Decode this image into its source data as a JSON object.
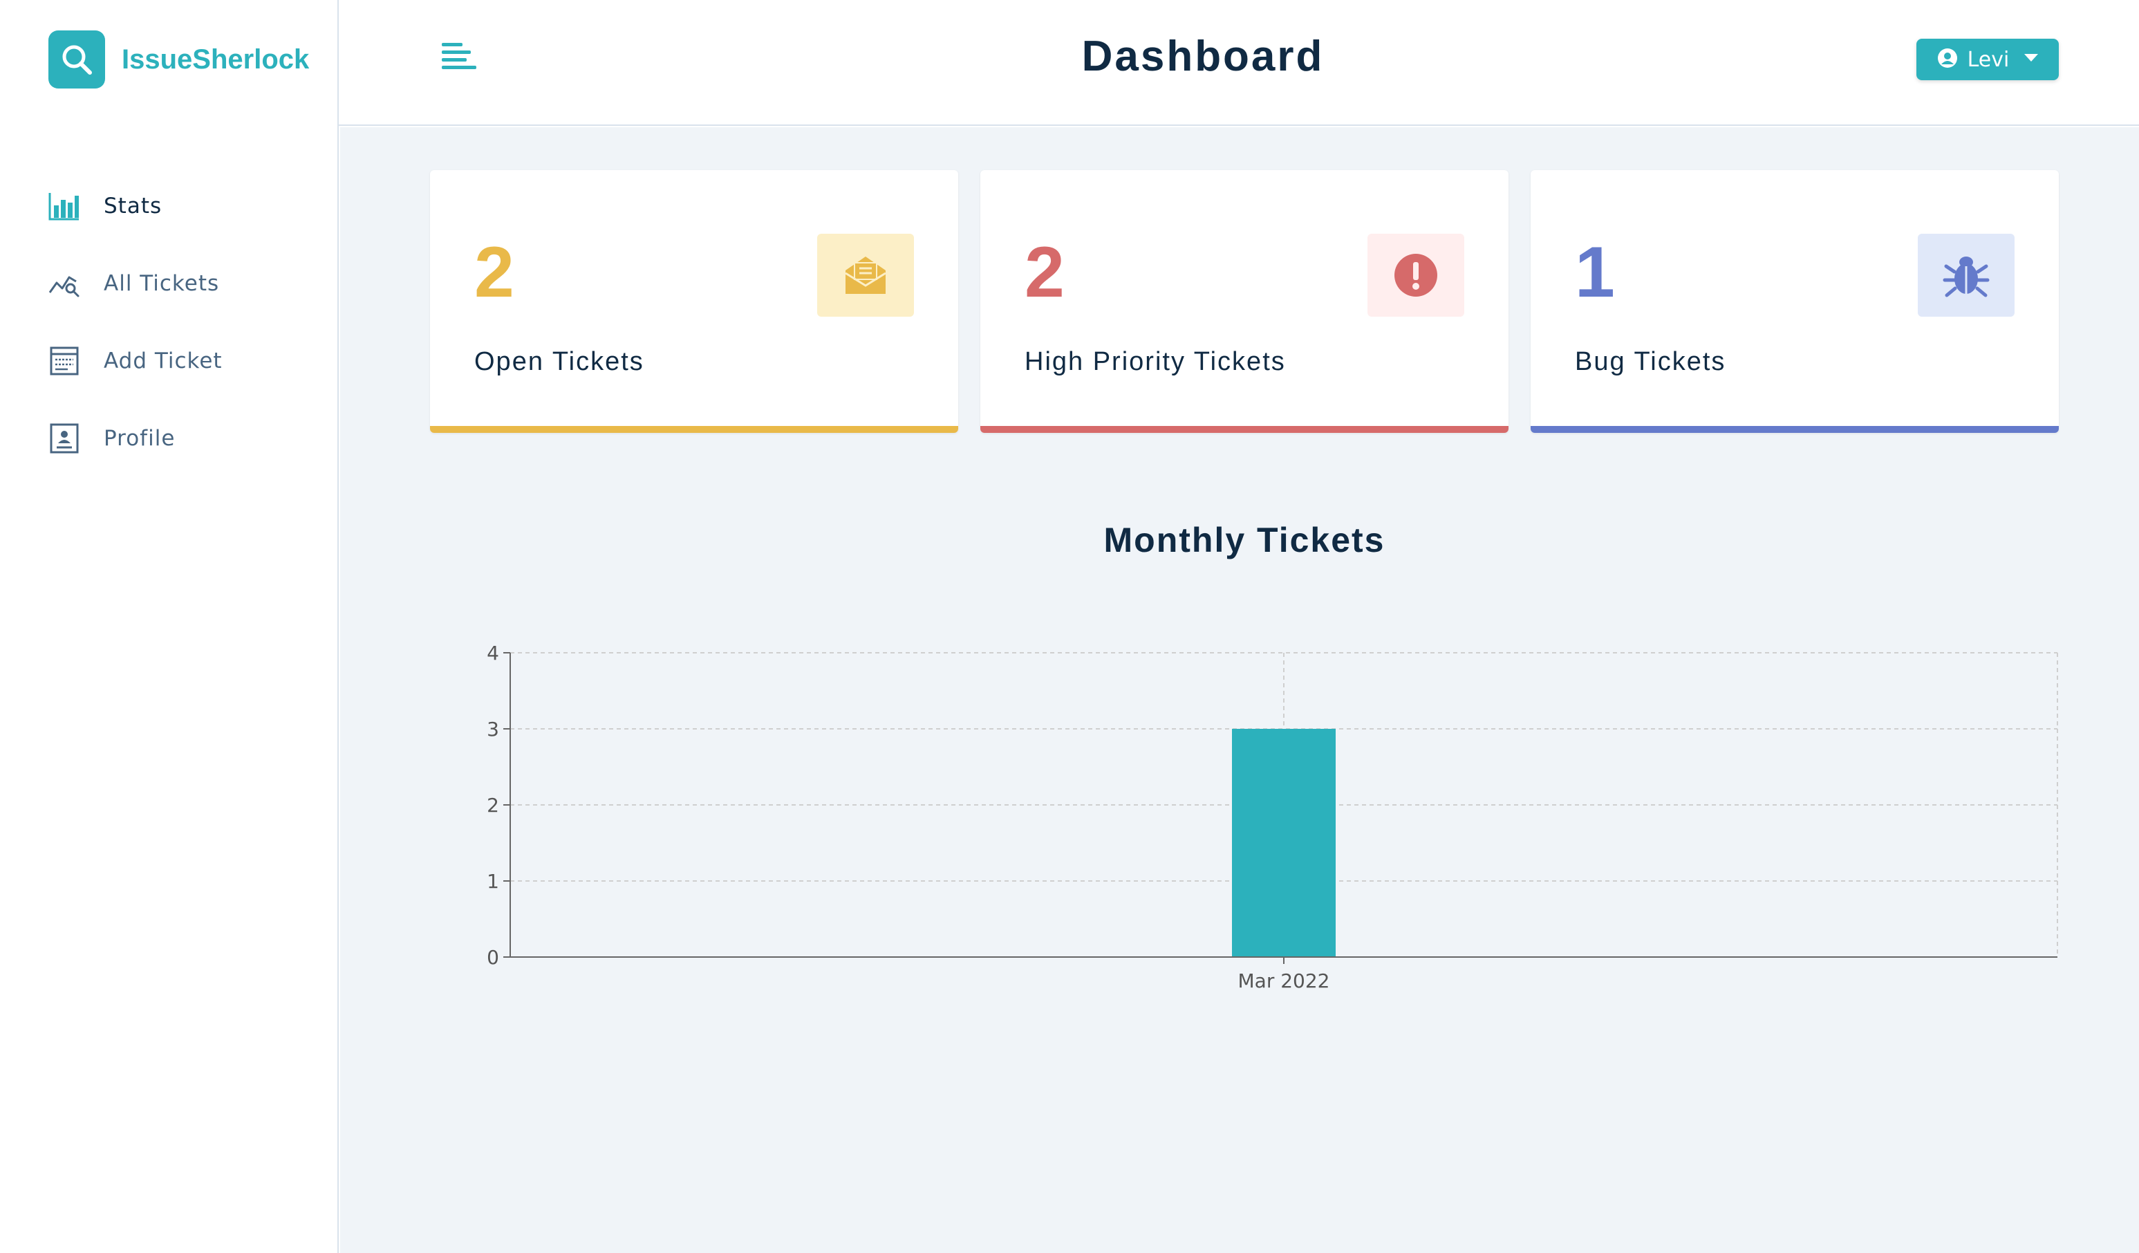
{
  "app": {
    "brand": "IssueSherlock"
  },
  "header": {
    "title": "Dashboard",
    "user_name": "Levi"
  },
  "sidebar": {
    "items": [
      {
        "label": "Stats",
        "icon": "bar-chart-icon",
        "active": true
      },
      {
        "label": "All Tickets",
        "icon": "line-chart-search-icon",
        "active": false
      },
      {
        "label": "Add Ticket",
        "icon": "form-icon",
        "active": false
      },
      {
        "label": "Profile",
        "icon": "profile-card-icon",
        "active": false
      }
    ]
  },
  "stats": [
    {
      "count": "2",
      "title": "Open Tickets",
      "icon": "envelope-open-icon",
      "color": "#e9b949",
      "icon_bg": "#fcefc7"
    },
    {
      "count": "2",
      "title": "High Priority Tickets",
      "icon": "exclamation-circle-icon",
      "color": "#d66a6a",
      "icon_bg": "#ffeeee"
    },
    {
      "count": "1",
      "title": "Bug Tickets",
      "icon": "bug-icon",
      "color": "#647acb",
      "icon_bg": "#e0e8f9"
    }
  ],
  "colors": {
    "accent": "#2cb1bc",
    "background": "#f0f4f8",
    "text_dark": "#102a43",
    "text_muted": "#486581"
  },
  "chart_data": {
    "type": "bar",
    "title": "Monthly Tickets",
    "categories": [
      "Mar 2022"
    ],
    "values": [
      3
    ],
    "ylim": [
      0,
      4
    ],
    "yticks": [
      0,
      1,
      2,
      3,
      4
    ],
    "xlabel": "",
    "ylabel": "",
    "grid": true,
    "bar_color": "#2cb1bc"
  }
}
